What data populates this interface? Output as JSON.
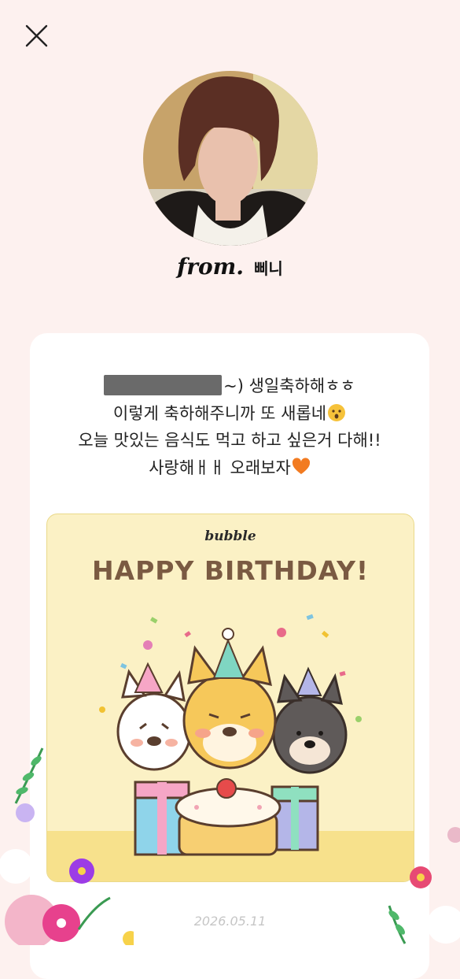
{
  "header": {
    "close_icon": "close-icon"
  },
  "profile": {
    "avatar_icon": "profile-photo",
    "from_label": "from.",
    "name": "삐니"
  },
  "message": {
    "line1_suffix": "~) 생일축하해ㅎㅎ",
    "line2": "이렇게 축하해주니까 또 새롭네",
    "line2_emoji": "hushed-face-emoji",
    "line3": "오늘 맛있는 음식도 먹고 하고 싶은거 다해!!",
    "line4": "사랑해ㅐㅐ 오래보자",
    "line4_emoji": "orange-heart-emoji"
  },
  "birthday_card": {
    "brand": "bubble",
    "title": "HAPPY BIRTHDAY!",
    "background_color": "#fbf1c5",
    "title_color": "#7a5a42"
  },
  "footer": {
    "date": "2026.05.11"
  },
  "colors": {
    "page_bg": "#fdf1ef",
    "card_bg": "#ffffff"
  }
}
